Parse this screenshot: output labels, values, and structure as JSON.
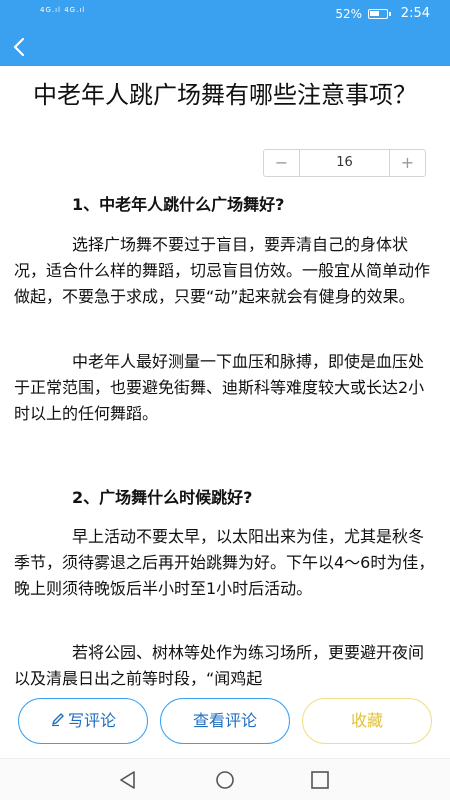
{
  "status_bar": {
    "signals": "4G.ıl 4G.ıl",
    "battery": "52%",
    "time": "2:54"
  },
  "header": {
    "back_icon": "chevron-left-icon"
  },
  "article": {
    "title": "中老年人跳广场舞有哪些注意事项？",
    "font_size_value": "16",
    "stepper_minus": "−",
    "stepper_plus": "+",
    "sections": [
      {
        "heading": "1、中老年人跳什么广场舞好?",
        "paragraphs": [
          "选择广场舞不要过于盲目，要弄清自己的身体状况，适合什么样的舞蹈，切忌盲目仿效。一般宜从简单动作做起，不要急于求成，只要“动”起来就会有健身的效果。",
          "中老年人最好测量一下血压和脉搏，即使是血压处于正常范围，也要避免街舞、迪斯科等难度较大或长达2小时以上的任何舞蹈。"
        ]
      },
      {
        "heading": "2、广场舞什么时候跳好?",
        "paragraphs": [
          "早上活动不要太早，以太阳出来为佳，尤其是秋冬季节，须待雾退之后再开始跳舞为好。下午以4～6时为佳，晚上则须待晚饭后半小时至1小时后活动。",
          "若将公园、树林等处作为练习场所，更要避开夜间以及清晨日出之前等时段，“闻鸡起"
        ]
      }
    ]
  },
  "actions": {
    "write_comment": "写评论",
    "write_icon": "pen-icon",
    "view_comments": "查看评论",
    "favorite": "收藏"
  },
  "colors": {
    "primary": "#3aa0f0",
    "button_text": "#1f6fc0",
    "favorite": "#e0c23a"
  }
}
